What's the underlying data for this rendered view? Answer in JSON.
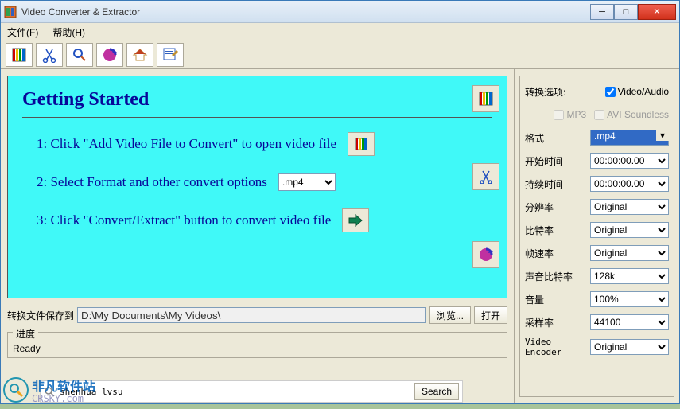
{
  "window": {
    "title": "Video Converter & Extractor"
  },
  "menu": {
    "file": "文件(F)",
    "help": "帮助(H)"
  },
  "getting_started": {
    "title": "Getting Started",
    "step1": "1: Click \"Add Video File to Convert\" to open video file",
    "step2": "2: Select Format and other convert options",
    "step3": "3: Click \"Convert/Extract\" button to convert video file",
    "format_sel": ".mp4"
  },
  "path": {
    "label": "转换文件保存到",
    "value": "D:\\My Documents\\My Videos\\",
    "browse": "浏览...",
    "open": "打开"
  },
  "progress": {
    "label": "进度",
    "status": "Ready"
  },
  "options": {
    "title": "转换选项:",
    "video_audio": "Video/Audio",
    "video_audio_checked": true,
    "mp3": "MP3",
    "mp3_checked": false,
    "avi_soundless": "AVI Soundless",
    "avi_soundless_checked": false,
    "format_label": "格式",
    "format_value": ".mp4",
    "start_label": "开始时间",
    "start_value": "00:00:00.00",
    "duration_label": "持续时间",
    "duration_value": "00:00:00.00",
    "resolution_label": "分辨率",
    "resolution_value": "Original",
    "bitrate_label": "比特率",
    "bitrate_value": "Original",
    "fps_label": "帧速率",
    "fps_value": "Original",
    "abitrate_label": "声音比特率",
    "abitrate_value": "128k",
    "volume_label": "音量",
    "volume_value": "100%",
    "sample_label": "采样率",
    "sample_value": "44100",
    "encoder_label": "Video Encoder",
    "encoder_value": "Original"
  },
  "search": {
    "value": "shenhua lvsu",
    "btn": "Search"
  },
  "watermark": {
    "t1": "非凡软件站",
    "t2": "CRSKY.com"
  }
}
